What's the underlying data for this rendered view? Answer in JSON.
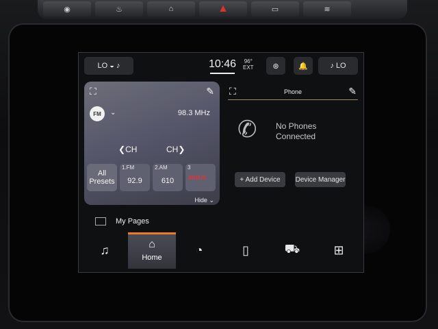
{
  "physical_buttons": [
    "",
    "",
    "",
    "",
    "",
    ""
  ],
  "status": {
    "left_pill": "LO",
    "time": "10:46",
    "temp_value": "96°",
    "temp_label": "EXT",
    "right_pill": "LO"
  },
  "radio": {
    "band": "FM",
    "frequency": "98.3 MHz",
    "prev_channel": "CH",
    "next_channel": "CH",
    "all_presets": "All Presets",
    "presets": [
      {
        "num": "1.FM",
        "value": "92.9"
      },
      {
        "num": "2.AM",
        "value": "610"
      },
      {
        "num": "3",
        "value": ""
      }
    ],
    "xm_label": "SIRIUS",
    "hide_label": "Hide"
  },
  "phone": {
    "title": "Phone",
    "message": "No Phones Connected",
    "add_device": "+ Add Device",
    "device_manager": "Device Manager"
  },
  "my_pages": "My Pages",
  "nav": {
    "home_label": "Home",
    "items": [
      "music-icon",
      "home-icon",
      "controls-icon",
      "phone-icon",
      "vehicle-icon",
      "apps-icon"
    ]
  },
  "colors": {
    "accent": "#f07a1f",
    "hazard": "#d9352b"
  }
}
